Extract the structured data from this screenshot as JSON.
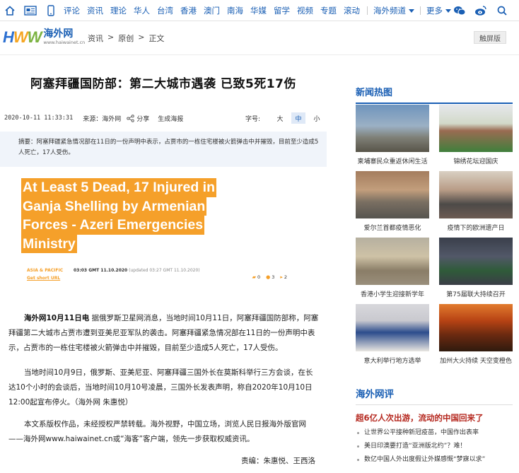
{
  "topnav": {
    "items": [
      "评论",
      "资讯",
      "理论",
      "华人",
      "台湾",
      "香港",
      "澳门",
      "南海",
      "华媒",
      "留学",
      "视频",
      "专题",
      "滚动"
    ],
    "channel": "海外频道",
    "more": "更多"
  },
  "header": {
    "logo_text": "HWW",
    "brand_cn": "海外网",
    "brand_url": "www.haiwainet.cn",
    "breadcrumb": [
      "资讯",
      ">",
      "原创",
      ">",
      "正文"
    ],
    "touch_button": "触屏版"
  },
  "article": {
    "title": "阿塞拜疆国防部：第二大城市遇袭 已致5死17伤",
    "date": "2020-10-11 11:33:31",
    "source": "来源：海外网",
    "share": "分享",
    "poster": "生成海报",
    "font_size_label": "字号:",
    "font_sizes": [
      "大",
      "中",
      "小"
    ],
    "summary": "摘要：阿塞拜疆紧急情况部在11日的一份声明中表示，占贾市的一栋住宅楼被火箭弹击中并摧毁，目前至少造成5人死亡，17人受伤。",
    "image": {
      "headline_lines": [
        "At Least 5 Dead, 17 Injured in",
        "Ganja Shelling by Armenian",
        "Forces - Azeri Emergencies",
        "Ministry"
      ],
      "tag": "ASIA & PACIFIC",
      "time": "03:03 GMT 11.10.2020",
      "updated": "(updated 03:27 GMT 11.10.2020)",
      "short_url": "Get short URL",
      "reactions": [
        "0",
        "3",
        "2"
      ]
    },
    "para1_lead": "海外网10月11日电",
    "para1": " 据俄罗斯卫星网消息，当地时间10月11日，阿塞拜疆国防部称，阿塞拜疆第二大城市占贾市遭到亚美尼亚军队的袭击。阿塞拜疆紧急情况部在11日的一份声明中表示，占贾市的一栋住宅楼被火箭弹击中并摧毁，目前至少造成5人死亡，17人受伤。",
    "para2": "当地时间10月9日，俄罗斯、亚美尼亚、阿塞拜疆三国外长在莫斯科举行三方会谈，在长达10个小时的会谈后，当地时间10月10号凌晨，三国外长发表声明，称自2020年10月10日12:00起宣布停火。（海外网 朱惠悦）",
    "para3": "本文系版权作品，未经授权严禁转载。海外视野，中国立场，浏览人民日报海外版官网——海外网www.haiwainet.cn或“海客”客户端，领先一步获取权威资讯。",
    "editor": "责编：朱惠悦、王西洛"
  },
  "sidebar": {
    "hot_title": "新闻热图",
    "cards": [
      {
        "caption": "柬埔寨民众重返休闲生活"
      },
      {
        "caption": "锦绣花坛迎国庆"
      },
      {
        "caption": "爱尔兰首都疫情恶化"
      },
      {
        "caption": "疫情下的欧洲遗产日"
      },
      {
        "caption": "香港小学生迎接新学年"
      },
      {
        "caption": "第75届联大持续召开"
      },
      {
        "caption": "意大利举行地方选举"
      },
      {
        "caption": "加州大火持续 天空变橙色"
      }
    ],
    "review_title": "海外网评",
    "review_lead": "超6亿人次出游，流动的中国回来了",
    "review_items": [
      "让世界公平接种新冠疫苗，中国作出表率",
      "美日印澳要打造“亚洲版北约”？难！",
      "数亿中国人外出度假让外媒感慨“梦寐以求”"
    ]
  }
}
